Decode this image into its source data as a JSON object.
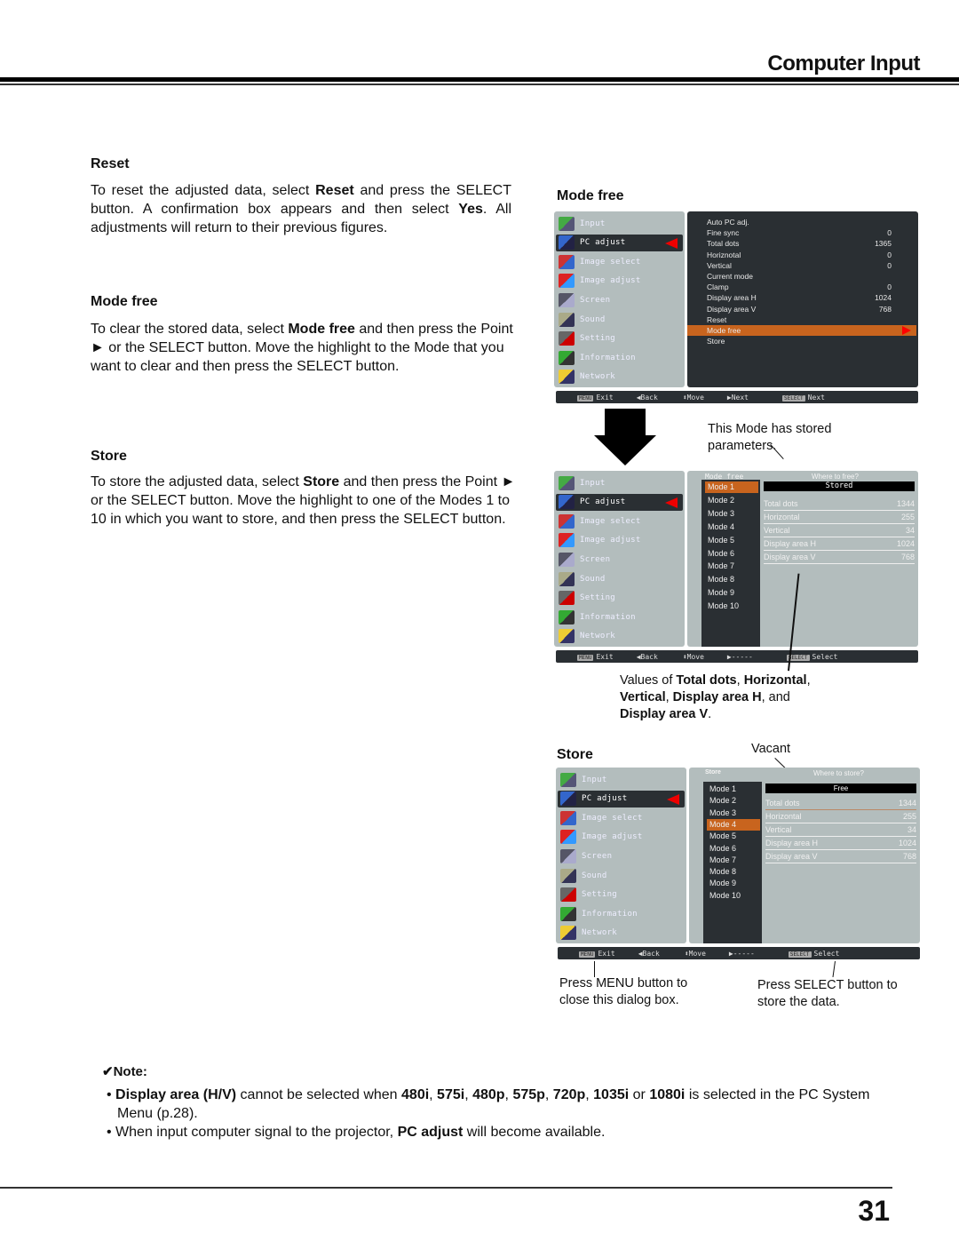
{
  "header": {
    "title": "Computer Input"
  },
  "sections": {
    "reset": {
      "heading": "Reset",
      "p1": "To reset the adjusted data, select ",
      "b1": "Reset",
      "p2": " and press the SELECT button. A confirmation box appears and then select ",
      "b2": "Yes",
      "p3": ". All adjustments will return to their previous figures."
    },
    "mode_free": {
      "heading": "Mode free",
      "p1": "To clear the stored data, select ",
      "b1": "Mode free",
      "p2": " and then press the Point ► or the SELECT button. Move the highlight to the Mode that you want to clear and then press the SELECT button."
    },
    "store": {
      "heading": "Store",
      "p1": "To store the adjusted data, select ",
      "b1": "Store",
      "p2": " and then press the Point ► or the SELECT button. Move the highlight to one of the Modes 1 to 10 in which you want to store, and then press the SELECT button."
    }
  },
  "figures": {
    "mode_free_heading": "Mode free",
    "store_heading": "Store",
    "main_menu": [
      {
        "label": "Input",
        "icon": "input-icon"
      },
      {
        "label": "PC adjust",
        "icon": "pc-adjust-icon"
      },
      {
        "label": "Image select",
        "icon": "image-select-icon"
      },
      {
        "label": "Image adjust",
        "icon": "image-adjust-icon"
      },
      {
        "label": "Screen",
        "icon": "screen-icon"
      },
      {
        "label": "Sound",
        "icon": "sound-icon"
      },
      {
        "label": "Setting",
        "icon": "setting-icon"
      },
      {
        "label": "Information",
        "icon": "information-icon"
      },
      {
        "label": "Network",
        "icon": "network-icon"
      }
    ],
    "pc_adjust_items": [
      {
        "label": "Auto PC adj.",
        "value": ""
      },
      {
        "label": "Fine sync",
        "value": "0"
      },
      {
        "label": "Total dots",
        "value": "1365"
      },
      {
        "label": "Horiznotal",
        "value": "0"
      },
      {
        "label": "Vertical",
        "value": "0"
      },
      {
        "label": "Current mode",
        "value": ""
      },
      {
        "label": "Clamp",
        "value": "0"
      },
      {
        "label": "Display area H",
        "value": "1024"
      },
      {
        "label": "Display area V",
        "value": "768"
      },
      {
        "label": "Reset",
        "value": ""
      },
      {
        "label": "Mode free",
        "value": ""
      },
      {
        "label": "Store",
        "value": ""
      }
    ],
    "bar1": {
      "exit": "Exit",
      "back": "Back",
      "move": "Move",
      "next": "Next",
      "select": "Next",
      "menu_key": "MENU",
      "select_key": "SELECT"
    },
    "bar2": {
      "exit": "Exit",
      "back": "Back",
      "move": "Move",
      "next": "-----",
      "select": "Select",
      "menu_key": "MENU",
      "select_key": "SELECT"
    },
    "modes": [
      "Mode 1",
      "Mode 2",
      "Mode 3",
      "Mode 4",
      "Mode 5",
      "Mode 6",
      "Mode 7",
      "Mode 8",
      "Mode 9",
      "Mode 10"
    ],
    "mode_free_dialog": {
      "title": "Mode free",
      "prompt": "Where to free?",
      "status": "Stored",
      "selected": "Mode 1"
    },
    "store_dialog": {
      "title": "Store",
      "prompt": "Where to store?",
      "status": "Free",
      "selected": "Mode 4"
    },
    "params": [
      {
        "label": "Total dots",
        "value": "1344"
      },
      {
        "label": "Horizontal",
        "value": "255"
      },
      {
        "label": "Vertical",
        "value": "34"
      },
      {
        "label": "Display area H",
        "value": "1024"
      },
      {
        "label": "Display area V",
        "value": "768"
      }
    ],
    "annotations": {
      "stored": "This Mode has stored parameters.",
      "values_pre": "Values of ",
      "values_b1": "Total dots",
      "values_c1": ", ",
      "values_b2": "Horizontal",
      "values_c2": ",",
      "values_b3": "Vertical",
      "values_c3": ", ",
      "values_b4": "Display area H",
      "values_c4": ", and",
      "values_b5": "Display area V",
      "values_c5": ".",
      "vacant": "Vacant",
      "menu_btn": "Press MENU button to close this dialog box.",
      "select_btn": "Press SELECT button to store the data."
    }
  },
  "note": {
    "title": "✔Note:",
    "b1_parts": [
      {
        "t": "Display area (H/V)",
        "b": true
      },
      {
        "t": " cannot be selected when ",
        "b": false
      },
      {
        "t": "480i",
        "b": true
      },
      {
        "t": ", ",
        "b": false
      },
      {
        "t": "575i",
        "b": true
      },
      {
        "t": ", ",
        "b": false
      },
      {
        "t": "480p",
        "b": true
      },
      {
        "t": ", ",
        "b": false
      },
      {
        "t": "575p",
        "b": true
      },
      {
        "t": ", ",
        "b": false
      },
      {
        "t": "720p",
        "b": true
      },
      {
        "t": ", ",
        "b": false
      },
      {
        "t": "1035i",
        "b": true
      },
      {
        "t": " or ",
        "b": false
      },
      {
        "t": "1080i",
        "b": true
      },
      {
        "t": " is selected in the PC System Menu (p.28).",
        "b": false
      }
    ],
    "b2_pre": "When input computer signal to the projector, ",
    "b2_bold": "PC adjust",
    "b2_post": " will become available."
  },
  "footer": {
    "page_number": "31"
  },
  "colors": {
    "highlight": "#c8641e",
    "menu_bg": "#b3bdbd",
    "panel_dark": "#2a2f33",
    "pointer": "#e00000"
  }
}
